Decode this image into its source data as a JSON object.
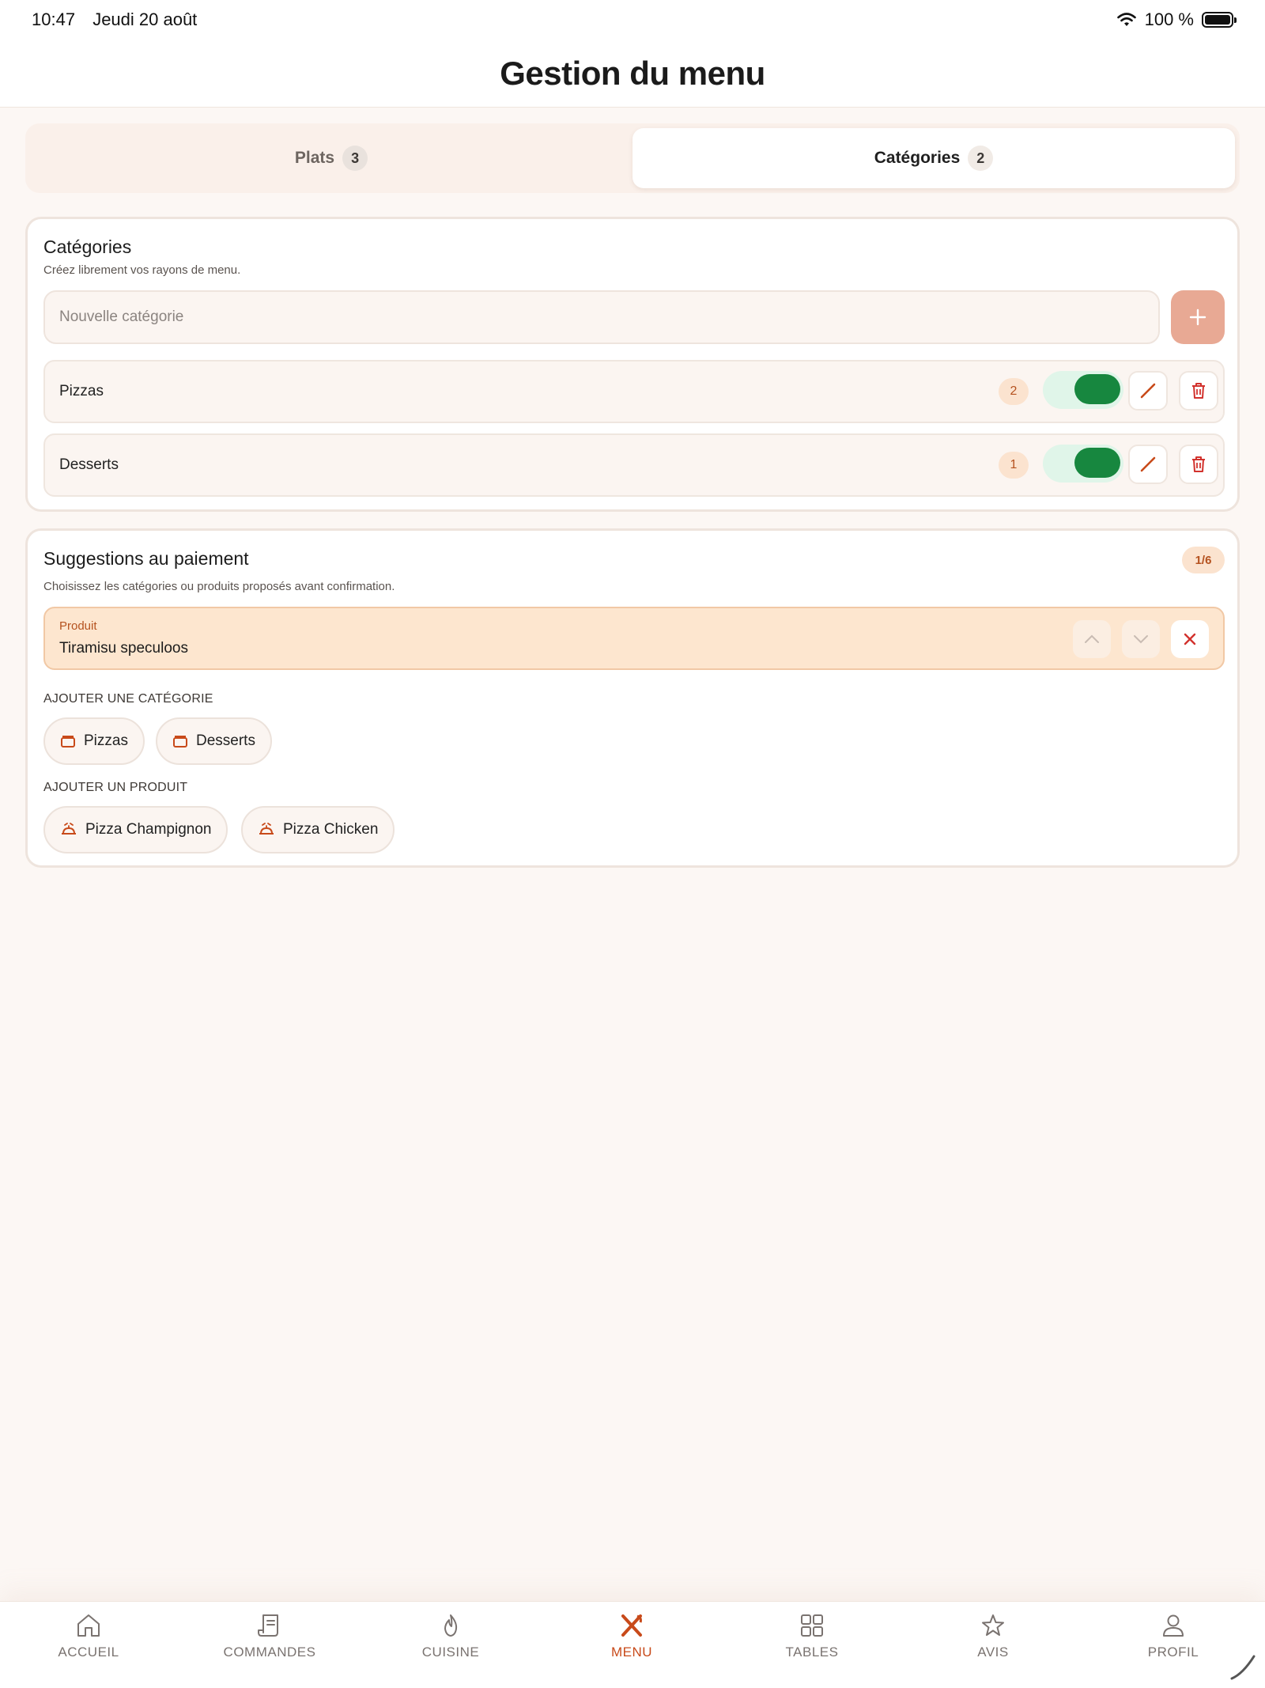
{
  "status_bar": {
    "time": "10:47",
    "date": "Jeudi 20 août",
    "battery": "100 %"
  },
  "header": {
    "title": "Gestion du menu"
  },
  "tabs": [
    {
      "label": "Plats",
      "count": "3",
      "active": false
    },
    {
      "label": "Catégories",
      "count": "2",
      "active": true
    }
  ],
  "categories_card": {
    "title": "Catégories",
    "subtitle": "Créez librement vos rayons de menu.",
    "input_placeholder": "Nouvelle catégorie",
    "add_icon": "plus-icon",
    "items": [
      {
        "name": "Pizzas",
        "count": "2",
        "enabled": true
      },
      {
        "name": "Desserts",
        "count": "1",
        "enabled": true
      }
    ]
  },
  "suggestions_card": {
    "title": "Suggestions au paiement",
    "subtitle": "Choisissez les catégories ou produits proposés avant confirmation.",
    "counter": "1/6",
    "selected": [
      {
        "kind": "Produit",
        "name": "Tiramisu speculoos"
      }
    ],
    "add_category_label": "AJOUTER UNE CATÉGORIE",
    "category_chips": [
      "Pizzas",
      "Desserts"
    ],
    "add_product_label": "AJOUTER UN PRODUIT",
    "product_chips": [
      "Pizza Champignon",
      "Pizza Chicken"
    ]
  },
  "bottom_nav": [
    {
      "label": "ACCUEIL",
      "icon": "home-icon"
    },
    {
      "label": "COMMANDES",
      "icon": "receipt-icon"
    },
    {
      "label": "CUISINE",
      "icon": "flame-icon"
    },
    {
      "label": "MENU",
      "icon": "utensils-icon",
      "active": true
    },
    {
      "label": "TABLES",
      "icon": "grid-icon"
    },
    {
      "label": "AVIS",
      "icon": "star-icon"
    },
    {
      "label": "PROFIL",
      "icon": "user-icon"
    }
  ],
  "colors": {
    "accent": "#c84a1a",
    "toggle_on": "#17873f",
    "badge_bg": "#fbe3cf",
    "selected_bg": "#fde6cf",
    "page_bg": "#fcf7f4"
  }
}
